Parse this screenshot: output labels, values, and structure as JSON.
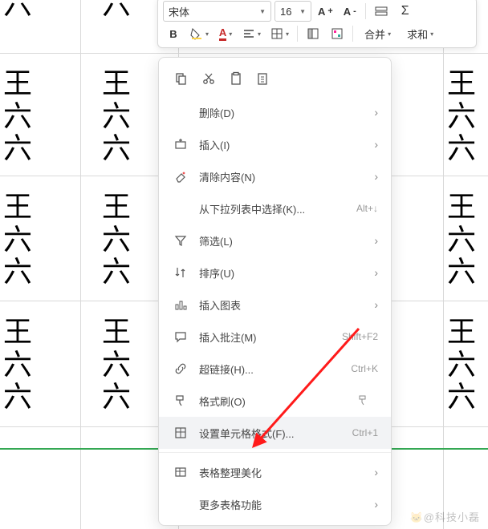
{
  "toolbar": {
    "font_name": "宋体",
    "font_size": "16",
    "merge_label": "合并",
    "sum_label": "求和"
  },
  "cell_text": "王\n六\n六",
  "context_menu": {
    "delete": "删除(D)",
    "insert": "插入(I)",
    "clear": "清除内容(N)",
    "dropdown_select": "从下拉列表中选择(K)...",
    "dropdown_shortcut": "Alt+↓",
    "filter": "筛选(L)",
    "sort": "排序(U)",
    "chart": "插入图表",
    "comment": "插入批注(M)",
    "comment_shortcut": "Shift+F2",
    "hyperlink": "超链接(H)...",
    "hyperlink_shortcut": "Ctrl+K",
    "format_painter": "格式刷(O)",
    "format_cells": "设置单元格格式(F)...",
    "format_cells_shortcut": "Ctrl+1",
    "table_beautify": "表格整理美化",
    "more_table": "更多表格功能"
  },
  "watermark": "🐱@科技小磊"
}
